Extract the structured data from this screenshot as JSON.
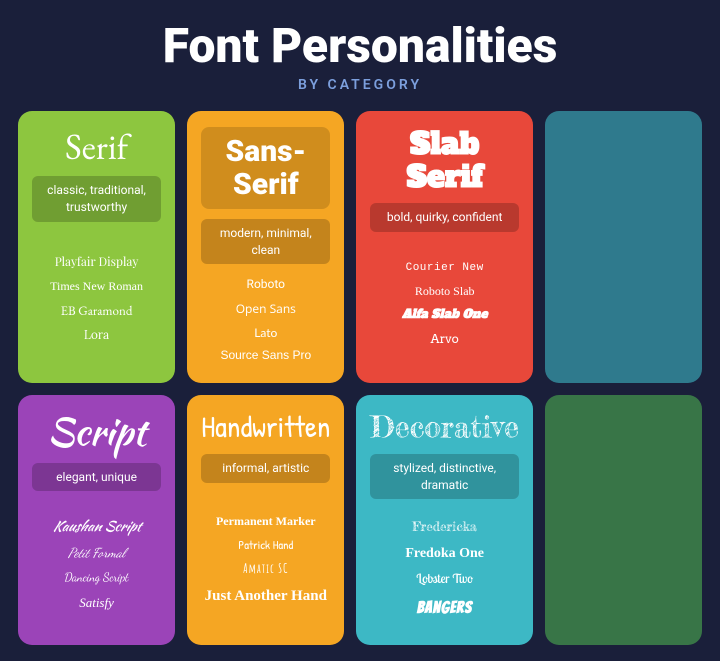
{
  "header": {
    "title": "Font Personalities",
    "subtitle": "BY CATEGORY"
  },
  "cards": [
    {
      "id": "serif",
      "title": "Serif",
      "description": "classic, traditional,\ntrustworthy",
      "fonts": [
        "Playfair Display",
        "Times New Roman",
        "EB Garamond",
        "Lora"
      ],
      "color": "#8dc63f"
    },
    {
      "id": "sans-serif",
      "title": "Sans-Serif",
      "description": "modern, minimal, clean",
      "fonts": [
        "Roboto",
        "Open Sans",
        "Lato",
        "Source Sans Pro"
      ],
      "color": "#f5a623"
    },
    {
      "id": "slab-serif",
      "title": "Slab Serif",
      "description": "bold, quirky, confident",
      "fonts": [
        "Courier New",
        "Roboto Slab",
        "Alfa Slab One",
        "Arvo"
      ],
      "color": "#e8483a"
    },
    {
      "id": "script",
      "title": "Script",
      "description": "elegant, unique",
      "fonts": [
        "Kaushan Script",
        "Petit Formal",
        "Dancing Script",
        "Satisfy"
      ],
      "color": "#9b44b8"
    },
    {
      "id": "handwritten",
      "title": "Handwritten",
      "description": "informal, artistic",
      "fonts": [
        "Permanent Marker",
        "Patrick Hand",
        "Amatic SC",
        "Just Another Hand"
      ],
      "color": "#f5a623"
    },
    {
      "id": "decorative",
      "title": "Decorative",
      "description": "stylized, distinctive,\ndramatic",
      "fonts": [
        "Fredericka",
        "Fredoka One",
        "Lobster Two",
        "Bangers"
      ],
      "color": "#3db8c5"
    }
  ]
}
